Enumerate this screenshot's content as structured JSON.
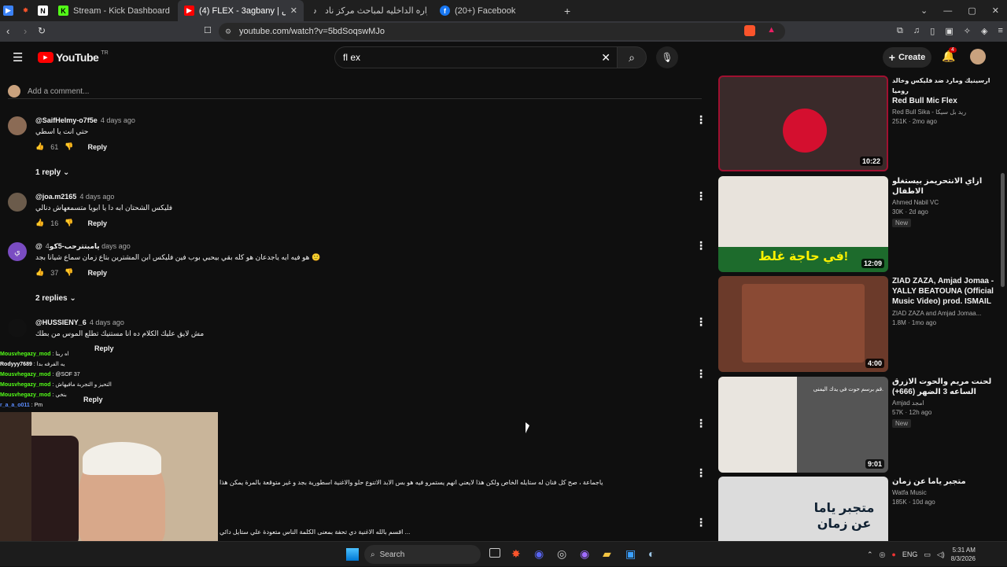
{
  "browser": {
    "tabs": [
      {
        "label": "",
        "icon": "app-icon"
      },
      {
        "label": "",
        "icon": "brave-icon"
      },
      {
        "label": "",
        "icon": "notion-icon"
      },
      {
        "label": "Stream - Kick Dashboard",
        "icon": "kick-icon"
      },
      {
        "label": "(4) FLEX - 3agbany | عجباني - ..نس",
        "icon": "youtube-icon"
      },
      {
        "label": "استعانه لوزاره الداخليه لمباحث مركز ناد...",
        "icon": "tiktok-icon"
      },
      {
        "label": "(20+) Facebook",
        "icon": "facebook-icon"
      }
    ],
    "url": "youtube.com/watch?v=5bdSoqswMJo"
  },
  "youtube": {
    "logo": "YouTube",
    "country": "TR",
    "search_value": "fl ex",
    "create_label": "Create",
    "notif_count": "4"
  },
  "comments": {
    "add_placeholder": "Add a comment...",
    "items": [
      {
        "author": "@SaifHelmy-o7f5e",
        "ago": "4 days ago",
        "text": "حتي انت يا اسطي",
        "likes": "61",
        "reply": "Reply"
      },
      {
        "author": "@joa.m2165",
        "ago": "4 days ago",
        "text": "فليكس الشحتان ابه دا يا ابويا متسمعهاش دنالي",
        "likes": "16",
        "reply": "Reply"
      },
      {
        "author": "@يامبتترحب-5كو",
        "ago": "4 days ago",
        "text": "هو فيه ايه ياجدعان هو كله بقي بيحبي بوب فين فليكس ابن المشترين بتاع زمان سماع شيانا بجد 🙂",
        "likes": "37",
        "reply": "Reply"
      },
      {
        "author": "@HUSSIENY_6",
        "ago": "4 days ago",
        "text": "مش لايق عليك الكلام ده انا مستنيك تطلع الموس من بطك",
        "likes": "",
        "reply": "Reply"
      }
    ],
    "reply_toggles": [
      "1 reply",
      "2 replies"
    ],
    "long_text_1": "بالش تختلف ياجماعة ، صح كل فنان له ستايله الخاص ولكن هذا لايعني انهم يستمرو فيه هو بس الابد الاتنوع حلو والاغنية اسطورية بجد و غير متوقعة بالمرة يمكن هذا",
    "long_text_2": "اقسم بالله الاغنية دي تحفة بمعنى الكلمة الناس متعودة علي ستايل دائي ..."
  },
  "chat": [
    {
      "user": "Mousvhegazy_mod",
      "msg": "اه ربنا"
    },
    {
      "user": "Rodyyy7689",
      "msg": "يه الفرفه بدا"
    },
    {
      "user": "Mousvhegazy_mod",
      "msg": "@SOF 37"
    },
    {
      "user": "Mousvhegazy_mod",
      "msg": "التحيز و التجربة مافيهاش"
    },
    {
      "user": "Mousvhegazy_mod",
      "msg": "بنخي"
    },
    {
      "user": "r_a_a_o011",
      "msg": "Pm"
    }
  ],
  "reply_label": "Reply",
  "videos": [
    {
      "title_ar": "ارسينيك ومارد ضد فليكس وخالد روميا",
      "title": "Red Bull Mic Flex",
      "channel": "Red Bull Sika - ريد بل سيكا",
      "views": "251K",
      "ago": "2mo ago",
      "duration": "10:22",
      "is_new": false,
      "thumb_color": "#3a2a2a"
    },
    {
      "title_ar": "",
      "title": "ازاي الانتحريمز بيستغلو الاطفال",
      "channel": "Ahmed Nabil VC",
      "views": "30K",
      "ago": "2d ago",
      "duration": "12:09",
      "is_new": true,
      "thumb_color": "#1d6b2c"
    },
    {
      "title_ar": "",
      "title": "ZIAD ZAZA, Amjad Jomaa - YALLY BEATOUNA (Official Music Video) prod. ISMAIL ...",
      "channel": "ZIAD ZAZA and Amjad Jomaa...",
      "views": "1.8M",
      "ago": "1mo ago",
      "duration": "4:00",
      "is_new": false,
      "thumb_color": "#6b3a2a"
    },
    {
      "title_ar": "",
      "title": "لحنت مريم والحوت الازرق الساعه 3 الضهر (666+)",
      "channel": "Amjad امجد",
      "views": "57K",
      "ago": "12h ago",
      "duration": "9:01",
      "is_new": true,
      "thumb_color": "#555"
    },
    {
      "title_ar": "",
      "title": "متجبر ياما عن زمان",
      "channel": "Watfa Music",
      "views": "185K",
      "ago": "10d ago",
      "duration": "",
      "is_new": false,
      "thumb_color": "#bbb"
    }
  ],
  "thumb_text": [
    "في حاجة غلط!",
    "متجبر ياما عن زمان",
    "قم برسم حوت في يدك اليمنى."
  ],
  "taskbar": {
    "search": "Search",
    "lang": "ENG",
    "time": "5:31 AM",
    "date": "8/3/2026"
  }
}
